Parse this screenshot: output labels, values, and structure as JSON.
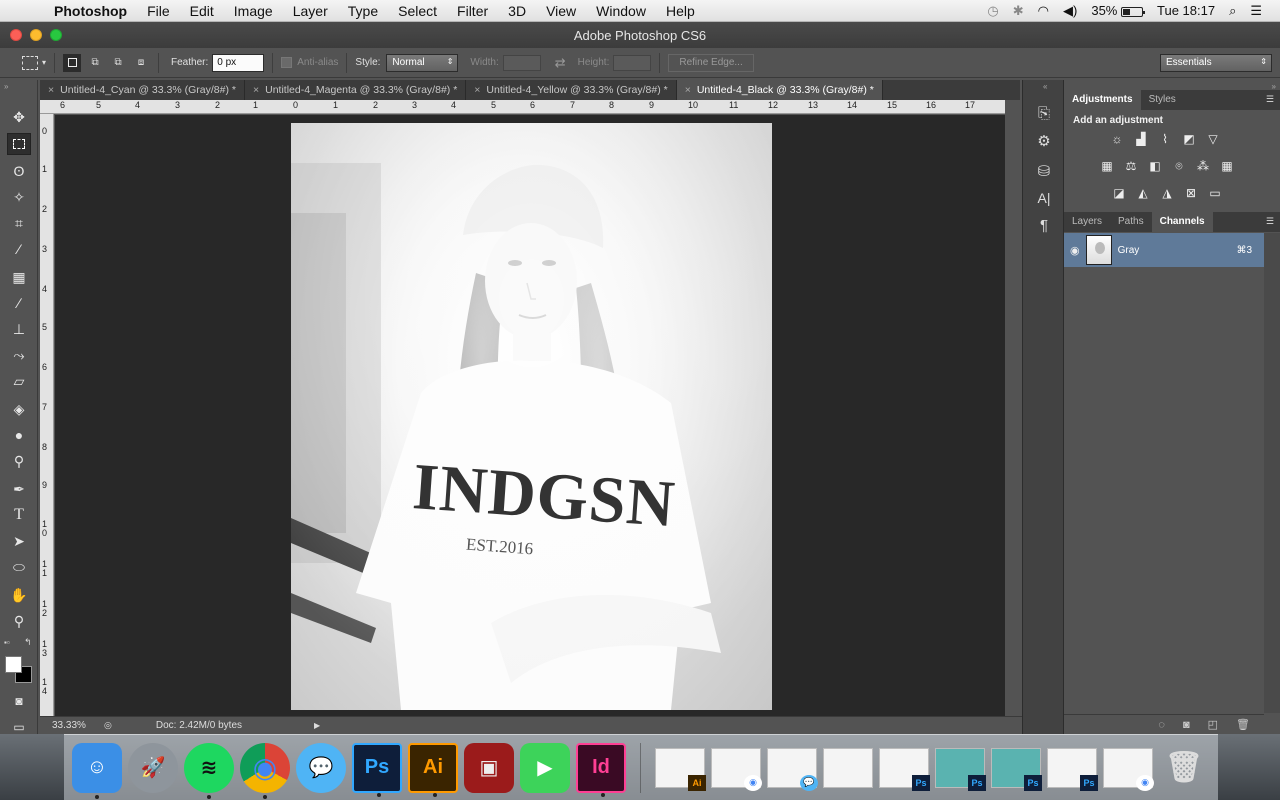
{
  "menubar": {
    "app_name": "Photoshop",
    "items": [
      "File",
      "Edit",
      "Image",
      "Layer",
      "Type",
      "Select",
      "Filter",
      "3D",
      "View",
      "Window",
      "Help"
    ],
    "battery": "35%",
    "clock": "Tue 18:17"
  },
  "window": {
    "title": "Adobe Photoshop CS6"
  },
  "options_bar": {
    "feather_label": "Feather:",
    "feather_value": "0 px",
    "antialias_label": "Anti-alias",
    "style_label": "Style:",
    "style_value": "Normal",
    "width_label": "Width:",
    "height_label": "Height:",
    "refine_edge_label": "Refine Edge...",
    "workspace_value": "Essentials"
  },
  "tabs": [
    {
      "label": "Untitled-4_Cyan @ 33.3% (Gray/8#) *",
      "active": false
    },
    {
      "label": "Untitled-4_Magenta @ 33.3% (Gray/8#) *",
      "active": false
    },
    {
      "label": "Untitled-4_Yellow @ 33.3% (Gray/8#) *",
      "active": false
    },
    {
      "label": "Untitled-4_Black @ 33.3% (Gray/8#) *",
      "active": true
    }
  ],
  "ruler_h": [
    "6",
    "5",
    "4",
    "3",
    "2",
    "1",
    "0",
    "1",
    "2",
    "3",
    "4",
    "5",
    "6",
    "7",
    "8",
    "9",
    "10",
    "11",
    "12",
    "13",
    "14",
    "15",
    "16",
    "17"
  ],
  "ruler_v": [
    "0",
    "1",
    "2",
    "3",
    "4",
    "5",
    "6",
    "7",
    "8",
    "9",
    "1 0",
    "1 1",
    "1 2",
    "1 3",
    "1 4"
  ],
  "photo": {
    "shirt_text": "INDGSN",
    "shirt_subtext": "EST.2016"
  },
  "status": {
    "zoom": "33.33%",
    "doc_info": "Doc: 2.42M/0 bytes"
  },
  "panels": {
    "top_tabs": [
      "Adjustments",
      "Styles"
    ],
    "add_adjustment": "Add an adjustment",
    "bottom_tabs": [
      "Layers",
      "Paths",
      "Channels"
    ],
    "channel": {
      "name": "Gray",
      "shortcut": "⌘3"
    }
  },
  "dock": {
    "apps": [
      {
        "name": "Finder",
        "label": "☺",
        "bg": "#3b8fe6"
      },
      {
        "name": "Launchpad",
        "label": "🚀",
        "bg": "#8e959c"
      },
      {
        "name": "Spotify",
        "label": "≋",
        "bg": "#1ed760"
      },
      {
        "name": "Chrome",
        "label": "◉",
        "bg": "#e8e8e8"
      },
      {
        "name": "Messages",
        "label": "💬",
        "bg": "#4fb4f5"
      },
      {
        "name": "Photoshop",
        "label": "Ps",
        "bg": "#0e1e3a"
      },
      {
        "name": "Illustrator",
        "label": "Ai",
        "bg": "#3a2400"
      },
      {
        "name": "Photo Booth",
        "label": "▣",
        "bg": "#9b1b1b"
      },
      {
        "name": "FaceTime",
        "label": "▶",
        "bg": "#3dd35a"
      },
      {
        "name": "InDesign",
        "label": "Id",
        "bg": "#3a0a24"
      }
    ],
    "windows": [
      "Ai",
      "Chrome",
      "Messages",
      "",
      "Ps",
      "Ps",
      "Ps",
      "Ps",
      "Chrome"
    ],
    "trash": "Trash"
  }
}
